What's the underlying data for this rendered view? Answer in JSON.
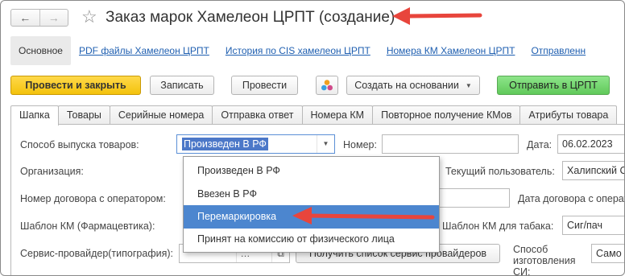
{
  "window": {
    "title": "Заказ марок Хамелеон ЦРПТ (создание)",
    "back_icon": "←",
    "forward_icon": "→",
    "star_icon": "☆"
  },
  "section_tabs": [
    {
      "label": "Основное",
      "active": true
    },
    {
      "label": "PDF файлы  Хамелеон ЦРПТ",
      "active": false
    },
    {
      "label": "История по CIS хамелеон ЦРПТ",
      "active": false
    },
    {
      "label": "Номера КМ Хамелеон ЦРПТ",
      "active": false
    },
    {
      "label": "Отправленн",
      "active": false
    }
  ],
  "toolbar": {
    "post_close": "Провести и закрыть",
    "save": "Записать",
    "post": "Провести",
    "create_based": "Создать на основании",
    "send_crpt": "Отправить в ЦРПТ"
  },
  "form_tabs": [
    "Шапка",
    "Товары",
    "Серийные номера",
    "Отправка ответ",
    "Номера КМ",
    "Повторное получение КМов",
    "Атрибуты товара"
  ],
  "form": {
    "release_method_label": "Способ выпуска товаров:",
    "release_method_value": "Произведен В РФ",
    "number_label": "Номер:",
    "number_value": "",
    "date_label": "Дата:",
    "date_value": "06.02.2023",
    "org_label": "Организация:",
    "current_user_label": "Текущий пользователь:",
    "current_user_value": "Халипский С",
    "contract_label": "Номер договора с оператором:",
    "contract_date_label": "Дата договора с операт",
    "template_pharma_label": "Шаблон КМ (Фармацевтика):",
    "template_tobacco_label": "Шаблон КМ для табака:",
    "template_tobacco_value": "Сиг/пач",
    "service_provider_label": "Сервис-провайдер(типография):",
    "get_providers_button": "Получить список сервис провайдеров",
    "method_made_label": "Способ изготовления СИ:",
    "method_made_value": "Само"
  },
  "dropdown": {
    "options": [
      "Произведен В РФ",
      "Ввезен В РФ",
      "Перемаркировка",
      "Принят на комиссию от физического лица"
    ],
    "highlighted_index": 2
  },
  "colors": {
    "accent_link": "#1f5fb0",
    "primary_button": "#f3c20c",
    "green_button": "#60c95a",
    "selection": "#4c86cf",
    "annotation_arrow": "#e8453c"
  }
}
